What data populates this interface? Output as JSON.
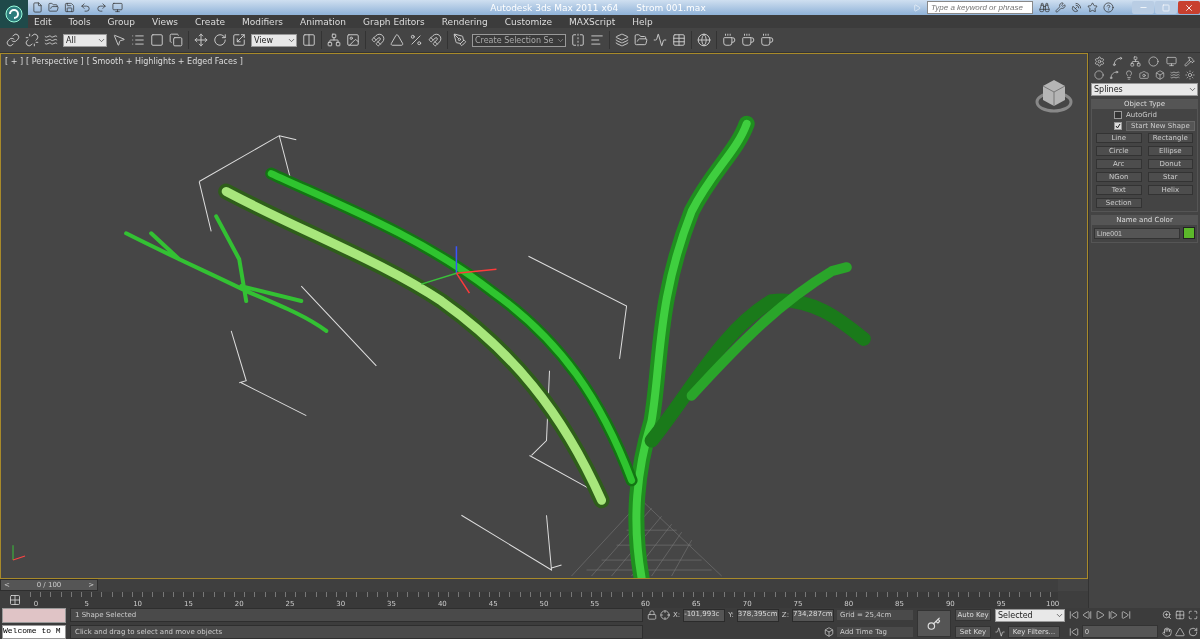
{
  "title_bar": {
    "app_title": "Autodesk 3ds Max  2011 x64",
    "file_name": "Strom 001.max",
    "search": {
      "placeholder": "Type a keyword or phrase"
    }
  },
  "menu": [
    "Edit",
    "Tools",
    "Group",
    "Views",
    "Create",
    "Modifiers",
    "Animation",
    "Graph Editors",
    "Rendering",
    "Customize",
    "MAXScript",
    "Help"
  ],
  "toolbar": {
    "selection_filter": "All",
    "reference_coord": "View",
    "named_selection": "Create Selection Se"
  },
  "viewport": {
    "labels": [
      "[ + ]",
      "[ Perspective ]",
      "[ Smooth + Highlights + Edged Faces ]"
    ]
  },
  "command_panel": {
    "category": "Splines",
    "object_type": {
      "title": "Object Type",
      "options": [
        {
          "label": "AutoGrid",
          "checked": false
        },
        {
          "label": "Start New Shape",
          "checked": true
        }
      ],
      "buttons": [
        "Line",
        "Rectangle",
        "Circle",
        "Ellipse",
        "Arc",
        "Donut",
        "NGon",
        "Star",
        "Text",
        "Helix",
        "Section"
      ]
    },
    "name_and_color": {
      "title": "Name and Color",
      "name": "Line001",
      "color": "#5cb82a"
    }
  },
  "time_slider": {
    "prev": "<",
    "label": "0 / 100",
    "next": ">"
  },
  "track_ticks": [
    "0",
    "5",
    "10",
    "15",
    "20",
    "25",
    "30",
    "35",
    "40",
    "45",
    "50",
    "55",
    "60",
    "65",
    "70",
    "75",
    "80",
    "85",
    "90",
    "95",
    "100"
  ],
  "status": {
    "listener": "Welcome to M",
    "selection": "1 Shape Selected",
    "prompt": "Click and drag to select and move objects",
    "coords": [
      {
        "axis": "X:",
        "value": "-101,993c"
      },
      {
        "axis": "Y:",
        "value": "378,395cm"
      },
      {
        "axis": "Z:",
        "value": "734,287cm"
      }
    ],
    "grid": "Grid = 25,4cm",
    "add_time_tag": "Add Time Tag",
    "auto_key": "Auto Key",
    "set_key": "Set Key",
    "key_mode": "Selected",
    "key_filters": "Key Filters...",
    "frame": "0"
  }
}
